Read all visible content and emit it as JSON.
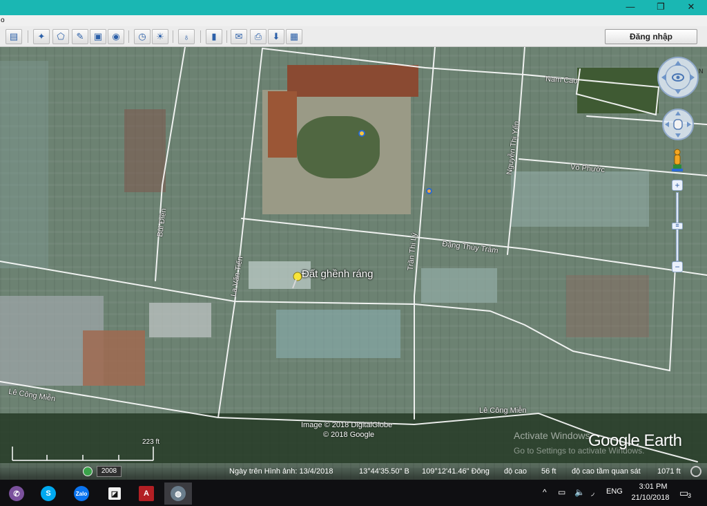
{
  "window": {
    "minimize_glyph": "—",
    "maximize_glyph": "❐",
    "close_glyph": "✕",
    "titlebar_color": "#1ab7b3"
  },
  "menu": {
    "fragment": "o"
  },
  "toolbar": {
    "buttons": [
      {
        "name": "sidebar-toggle-button",
        "icon": "sidebar-icon",
        "glyph": "▤"
      },
      {
        "name": "add-placemark-button",
        "icon": "pushpin-icon",
        "glyph": "✦"
      },
      {
        "name": "add-polygon-button",
        "icon": "polygon-icon",
        "glyph": "⬠"
      },
      {
        "name": "add-path-button",
        "icon": "path-icon",
        "glyph": "✎"
      },
      {
        "name": "add-overlay-button",
        "icon": "image-overlay-icon",
        "glyph": "▣"
      },
      {
        "name": "record-tour-button",
        "icon": "record-icon",
        "glyph": "◉"
      },
      {
        "name": "historical-imagery-button",
        "icon": "clock-icon",
        "glyph": "◷"
      },
      {
        "name": "sunlight-button",
        "icon": "sun-icon",
        "glyph": "☀"
      },
      {
        "name": "switch-sky-button",
        "icon": "planet-icon",
        "glyph": "♁"
      },
      {
        "name": "ruler-button",
        "icon": "ruler-icon",
        "glyph": "▮"
      },
      {
        "name": "email-button",
        "icon": "email-icon",
        "glyph": "✉"
      },
      {
        "name": "print-button",
        "icon": "printer-icon",
        "glyph": "⎙"
      },
      {
        "name": "save-image-button",
        "icon": "save-image-icon",
        "glyph": "⬇"
      },
      {
        "name": "view-in-maps-button",
        "icon": "map-icon",
        "glyph": "▦"
      }
    ],
    "login_label": "Đăng nhập"
  },
  "map": {
    "placemark_label": "Đất ghềnh ráng",
    "road_labels": {
      "nam_cao": "Nam Cao",
      "nguyen_thi_yen": "Nguyễn Thị Yến",
      "vo_phuoc": "Võ Phước",
      "bui_dien": "Bùi Điền",
      "dang_thuy_tram": "Đặng Thùy Trâm",
      "tran_thi_ly": "Trần Thị Lý",
      "la_van_tien": "La Văn Tiến",
      "le_cong_mien_left": "Lê Công Miễn",
      "le_cong_mien_right": "Lê Công Miễn"
    },
    "copyright_line1": "Image © 2018 DigitalGlobe",
    "copyright_line2": "© 2018 Google",
    "watermark_line1": "Activate Windows",
    "watermark_line2": "Go to Settings to activate Windows.",
    "logo_text": "Google Earth",
    "scale_label": "223 ft"
  },
  "nav": {
    "zoom_in": "+",
    "zoom_out": "−",
    "zoom_thumb": "≡",
    "north_label": "N"
  },
  "statusbar": {
    "year": "2008",
    "imagery_date": "Ngày trên Hình ảnh: 13/4/2018",
    "lat": "13°44'35.50\" B",
    "lon": "109°12'41.46\" Đông",
    "elev_label": "độ cao",
    "elev_value": "56 ft",
    "eye_label": "độ cao tầm quan sát",
    "eye_value": "1071 ft"
  },
  "taskbar": {
    "apps": [
      {
        "name": "viber-app",
        "icon": "viber-icon",
        "glyph": "✆",
        "color": "#7b519d"
      },
      {
        "name": "skype-app",
        "icon": "skype-icon",
        "glyph": "S",
        "color": "#00a9f0"
      },
      {
        "name": "zalo-app",
        "icon": "zalo-icon",
        "glyph": "Zalo",
        "color": "#0a74f0"
      },
      {
        "name": "sticky-notes-app",
        "icon": "notes-icon",
        "glyph": "◪",
        "color": "#222222"
      },
      {
        "name": "autocad-app",
        "icon": "autocad-icon",
        "glyph": "A",
        "color": "#b31f24"
      },
      {
        "name": "google-earth-app",
        "icon": "google-earth-icon",
        "glyph": "◍",
        "color": "#6a7d8c"
      }
    ],
    "tray": {
      "chevron": "^",
      "battery": "▭",
      "volume": "🔈",
      "network": "◞",
      "language": "ENG",
      "time": "3:01 PM",
      "date": "21/10/2018",
      "notifications": "3"
    }
  }
}
